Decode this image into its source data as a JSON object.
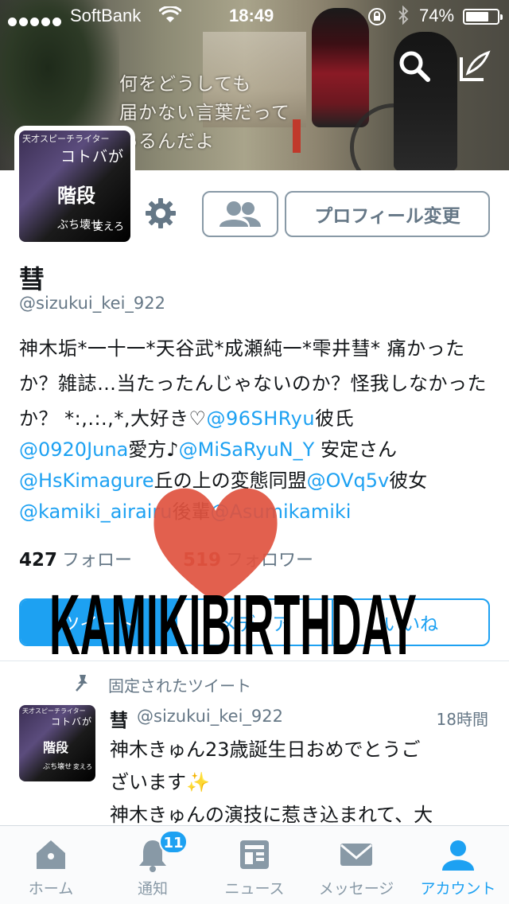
{
  "status_bar": {
    "carrier": "SoftBank",
    "time": "18:49",
    "battery_percent": "74%",
    "battery_level": 0.74
  },
  "header": {
    "banner_caption_lines": [
      "何をどうしても",
      "届かない言葉だって",
      "あるんだよ"
    ],
    "search_icon": "search-icon",
    "compose_icon": "compose-tweet-icon"
  },
  "avatar_image_text": {
    "line1": "天才スピーチライター",
    "line2": "コトバが",
    "line3": "階段",
    "line4": "ぶち壊せ",
    "line5": "変えろ"
  },
  "profile": {
    "display_name": "彗",
    "handle": "@sizukui_kei_922",
    "edit_profile_label": "プロフィール変更",
    "bio_plain": "神木垢*一十一*天谷武*成瀬純一*雫井彗* 痛かったか？雑誌…当たったんじゃないのか？怪我しなかったか？ *:,.:.,*,大好き♡",
    "bio_mention_1": "@96SHRyu",
    "bio_after_1": "彼氏",
    "mention_2": "@0920Juna",
    "after_2": "愛方♪",
    "mention_3": "@MiSaRyuN_Y",
    "after_3": " 安定さん",
    "mention_4": "@HsKimagure",
    "after_4": "丘の上の変態同盟",
    "mention_5": "@OVq5v",
    "after_5": "彼女",
    "mention_6": "@kamiki_airairu",
    "after_6": "後輩",
    "mention_7": "@Asumikamiki",
    "following_count": "427",
    "following_label": "フォロー",
    "followers_count": "519",
    "followers_label": "フォロワー"
  },
  "profile_tabs": {
    "tab1": "ツイート",
    "tab2": "メディア",
    "tab3": "いいね"
  },
  "sticker": {
    "text": "KAMIKIBIRTHDAY",
    "heart_color": "#e0533f"
  },
  "pinned_tweet": {
    "label": "固定されたツイート",
    "name": "彗",
    "handle": "@sizukui_kei_922",
    "time": "18時間",
    "line1": "神木きゅん23歳誕生日おめでとうご",
    "line2": "ざいます✨",
    "line3": "神木きゅんの演技に惹き込まれて、大"
  },
  "tab_bar": {
    "home": "ホーム",
    "notifications": "通知",
    "notifications_badge": "11",
    "news": "ニュース",
    "messages": "メッセージ",
    "account": "アカウント"
  },
  "colors": {
    "accent": "#1da1f2",
    "muted": "#657786",
    "followers_number": "#b03a2e"
  }
}
